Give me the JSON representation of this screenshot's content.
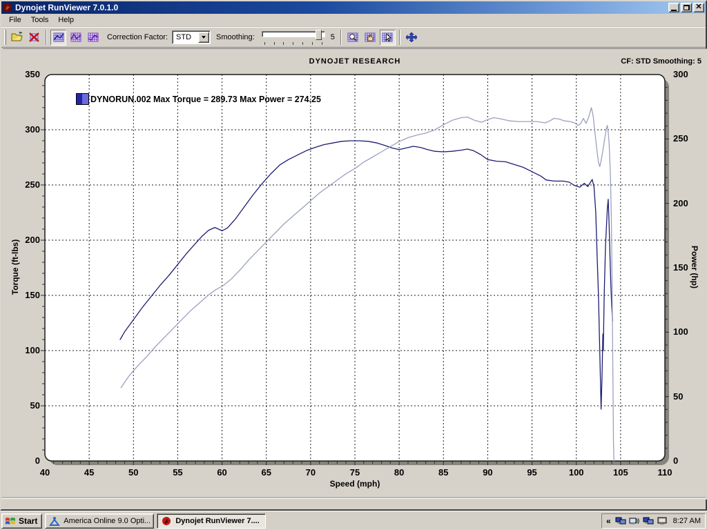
{
  "window": {
    "title": "Dynojet RunViewer 7.0.1.0",
    "buttons": [
      "minimize",
      "restore",
      "close"
    ]
  },
  "menu": {
    "items": [
      "File",
      "Tools",
      "Help"
    ]
  },
  "toolbar": {
    "correction_factor_label": "Correction Factor:",
    "correction_factor_value": "STD",
    "smoothing_label": "Smoothing:",
    "smoothing_value": "5",
    "icons": [
      "open-run-icon",
      "close-run-icon",
      "graph-mode-1-icon",
      "graph-mode-2-icon",
      "graph-mode-3-icon",
      "zoom-graph-icon",
      "pan-graph-icon",
      "select-graph-icon",
      "fit-axes-icon"
    ]
  },
  "chart": {
    "header_center": "DYNOJET RESEARCH",
    "header_right": "CF: STD  Smoothing: 5",
    "legend_text": "DYNORUN.002 Max Torque = 289.73 Max Power = 274.25",
    "legend_swatch_colors": [
      "#2424a8",
      "#6b6bdd"
    ]
  },
  "chart_data": {
    "type": "line",
    "title": "DYNOJET RESEARCH",
    "xlabel": "Speed (mph)",
    "ylabel_left": "Torque (ft-lbs)",
    "ylabel_right": "Power (hp)",
    "xlim": [
      40,
      110
    ],
    "ylim_left": [
      0,
      350
    ],
    "ylim_right": [
      0,
      300
    ],
    "xticks": [
      40,
      45,
      50,
      55,
      60,
      65,
      70,
      75,
      80,
      85,
      90,
      95,
      100,
      105,
      110
    ],
    "yticks_left": [
      0,
      50,
      100,
      150,
      200,
      250,
      300,
      350
    ],
    "yticks_right": [
      0,
      50,
      100,
      150,
      200,
      250,
      300
    ],
    "minor_x_step": 1,
    "minor_y_step": 10,
    "grid": "dashed",
    "legend_position": "top-left-inside",
    "series": [
      {
        "name": "DYNORUN.002 Torque",
        "axis": "left",
        "color": "#1b1b70",
        "max_label": "Max Torque = 289.73",
        "points": [
          [
            48.5,
            110
          ],
          [
            49,
            117
          ],
          [
            50,
            128
          ],
          [
            51,
            139
          ],
          [
            52,
            149
          ],
          [
            53,
            159
          ],
          [
            54,
            168
          ],
          [
            55,
            178
          ],
          [
            56,
            188
          ],
          [
            57,
            197
          ],
          [
            57.8,
            204
          ],
          [
            58.5,
            209
          ],
          [
            59.2,
            211.5
          ],
          [
            60,
            208.5
          ],
          [
            60.6,
            211
          ],
          [
            61.5,
            219
          ],
          [
            62.5,
            230
          ],
          [
            63.5,
            241
          ],
          [
            64.5,
            251
          ],
          [
            65.5,
            260
          ],
          [
            66.5,
            268
          ],
          [
            67.5,
            273
          ],
          [
            68.5,
            277
          ],
          [
            69.5,
            281
          ],
          [
            70.5,
            284
          ],
          [
            71.5,
            286.5
          ],
          [
            72.5,
            288
          ],
          [
            73.5,
            289.5
          ],
          [
            74.5,
            290
          ],
          [
            75.5,
            290
          ],
          [
            76.5,
            289.5
          ],
          [
            77.5,
            288
          ],
          [
            78.3,
            286
          ],
          [
            79.2,
            283.5
          ],
          [
            80,
            282
          ],
          [
            80.8,
            283.5
          ],
          [
            81.6,
            285
          ],
          [
            82.4,
            284
          ],
          [
            83.2,
            282
          ],
          [
            84,
            280.5
          ],
          [
            85,
            280
          ],
          [
            86,
            280.5
          ],
          [
            87,
            281.5
          ],
          [
            87.7,
            282.5
          ],
          [
            88.4,
            281
          ],
          [
            89.2,
            277.5
          ],
          [
            90,
            273
          ],
          [
            91,
            271.5
          ],
          [
            92,
            271
          ],
          [
            93,
            268.5
          ],
          [
            94,
            266
          ],
          [
            95,
            262
          ],
          [
            96,
            258
          ],
          [
            96.6,
            254.5
          ],
          [
            97.5,
            253.5
          ],
          [
            98.5,
            253.5
          ],
          [
            99.2,
            252.5
          ],
          [
            99.8,
            249.5
          ],
          [
            100.4,
            248
          ],
          [
            100.9,
            251.5
          ],
          [
            101.3,
            248.5
          ],
          [
            101.8,
            255
          ],
          [
            102,
            248
          ],
          [
            102.2,
            225
          ],
          [
            102.35,
            185
          ],
          [
            102.5,
            150
          ],
          [
            102.6,
            115
          ],
          [
            102.7,
            80
          ],
          [
            102.8,
            47
          ],
          [
            102.9,
            75
          ],
          [
            103,
            115
          ],
          [
            103.05,
            100
          ],
          [
            103.15,
            150
          ],
          [
            103.3,
            195
          ],
          [
            103.5,
            228
          ],
          [
            103.6,
            237
          ],
          [
            103.7,
            215
          ],
          [
            103.8,
            185
          ],
          [
            103.9,
            160
          ],
          [
            104,
            140
          ],
          [
            104.1,
            127
          ]
        ]
      },
      {
        "name": "DYNORUN.002 Power",
        "axis": "right",
        "color": "#9aa0bf",
        "max_label": "Max Power = 274.25",
        "points": [
          [
            48.6,
            57
          ],
          [
            49.5,
            66
          ],
          [
            50.5,
            74
          ],
          [
            51.5,
            81
          ],
          [
            52.5,
            89
          ],
          [
            53.5,
            96
          ],
          [
            54.5,
            103
          ],
          [
            55.5,
            110
          ],
          [
            56.5,
            117
          ],
          [
            57.5,
            123
          ],
          [
            58.5,
            129
          ],
          [
            59.3,
            133
          ],
          [
            60.1,
            136
          ],
          [
            61,
            141
          ],
          [
            62,
            148
          ],
          [
            63,
            156
          ],
          [
            64,
            163
          ],
          [
            65,
            170
          ],
          [
            66,
            177
          ],
          [
            67,
            184
          ],
          [
            68,
            190
          ],
          [
            69,
            196
          ],
          [
            70,
            202
          ],
          [
            71,
            208
          ],
          [
            72,
            213
          ],
          [
            73,
            218
          ],
          [
            74,
            223
          ],
          [
            75,
            227
          ],
          [
            76,
            232
          ],
          [
            77,
            236
          ],
          [
            78,
            240
          ],
          [
            79,
            244
          ],
          [
            80,
            248
          ],
          [
            81,
            251
          ],
          [
            82,
            253
          ],
          [
            83,
            254.5
          ],
          [
            84,
            257
          ],
          [
            85,
            261
          ],
          [
            86,
            264.5
          ],
          [
            87,
            266.5
          ],
          [
            87.7,
            267
          ],
          [
            88.5,
            264.5
          ],
          [
            89.3,
            263
          ],
          [
            90,
            265
          ],
          [
            90.7,
            266.5
          ],
          [
            91.5,
            265.5
          ],
          [
            92.5,
            264
          ],
          [
            93.5,
            263.5
          ],
          [
            94.5,
            263.5
          ],
          [
            95.5,
            263.5
          ],
          [
            96.5,
            262.5
          ],
          [
            97,
            264
          ],
          [
            97.5,
            266
          ],
          [
            98,
            265.5
          ],
          [
            98.7,
            264
          ],
          [
            99.3,
            263.5
          ],
          [
            99.8,
            262.5
          ],
          [
            100.2,
            260.5
          ],
          [
            100.5,
            262
          ],
          [
            100.8,
            266
          ],
          [
            101.1,
            262
          ],
          [
            101.4,
            267
          ],
          [
            101.7,
            274.3
          ],
          [
            101.9,
            268
          ],
          [
            102.1,
            255
          ],
          [
            102.3,
            243
          ],
          [
            102.5,
            232
          ],
          [
            102.65,
            228.5
          ],
          [
            102.8,
            233
          ],
          [
            103,
            241
          ],
          [
            103.2,
            250
          ],
          [
            103.4,
            258
          ],
          [
            103.5,
            260.5
          ],
          [
            103.6,
            255
          ],
          [
            103.7,
            247
          ],
          [
            103.85,
            222
          ],
          [
            103.95,
            190
          ],
          [
            104,
            165
          ],
          [
            104.05,
            131
          ],
          [
            104.1,
            90
          ],
          [
            104.15,
            50
          ],
          [
            104.2,
            13
          ],
          [
            104.25,
            0
          ]
        ]
      }
    ]
  },
  "taskbar": {
    "start_label": "Start",
    "tasks": [
      {
        "label": "America Online 9.0 Opti...",
        "active": false
      },
      {
        "label": "Dynojet RunViewer 7....",
        "active": true
      }
    ],
    "tray_chevron": "«",
    "tray_icons": [
      "network-icon",
      "wireless-audio-icon",
      "network-2-icon",
      "display-icon"
    ],
    "clock": "8:27 AM"
  }
}
